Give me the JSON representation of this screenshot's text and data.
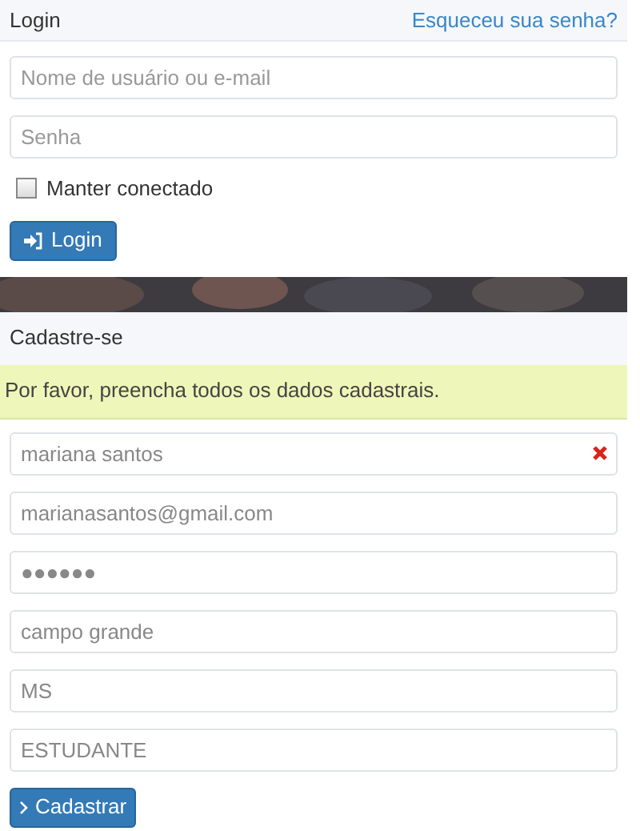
{
  "login": {
    "title": "Login",
    "forgot_link": "Esqueceu sua senha?",
    "fields": [
      {
        "placeholder": "Nome de usuário ou e-mail"
      },
      {
        "placeholder": "Senha"
      }
    ],
    "remember": {
      "label": "Manter conectado",
      "checked": false
    },
    "button": "Login"
  },
  "register": {
    "title": "Cadastre-se",
    "alert": "Por favor, preencha todos os dados cadastrais.",
    "fields": [
      {
        "value": "mariana santos",
        "error": true
      },
      {
        "value": "marianasantos@gmail.com",
        "error": false
      },
      {
        "value": "●●●●●●",
        "error": false
      },
      {
        "value": "campo grande",
        "error": false
      },
      {
        "value": "MS",
        "error": false
      },
      {
        "value": "ESTUDANTE",
        "error": false
      }
    ],
    "button": "Cadastrar"
  }
}
